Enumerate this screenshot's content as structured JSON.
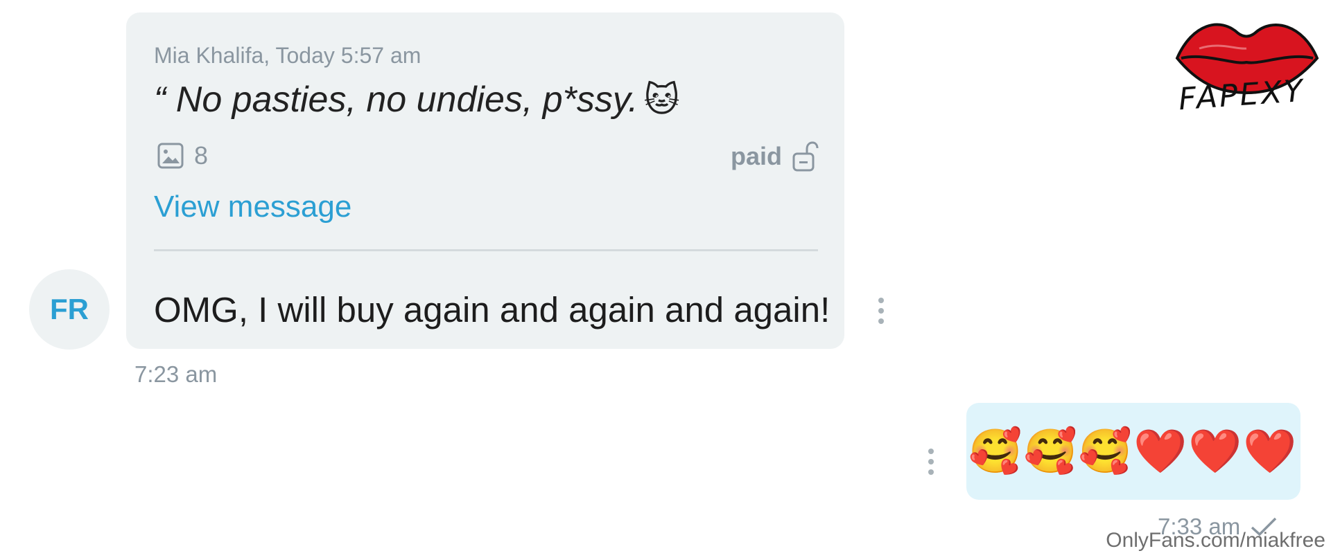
{
  "avatar": {
    "initials": "FR"
  },
  "incoming": {
    "quote_meta": "Mia Khalifa, Today 5:57 am",
    "quote_text": "“ No pasties, no undies, p*ssy.",
    "quote_emoji": "🐱",
    "media_count": "8",
    "price_status": "paid",
    "view_link": "View message",
    "message": "OMG, I will buy again and again and again!",
    "time": "7:23 am"
  },
  "outgoing": {
    "message": "🥰🥰🥰❤️❤️❤️",
    "time": "7:33 am"
  },
  "watermark": "OnlyFans.com/miakfree",
  "logo_text": "FAPEXY",
  "icons": {
    "media": "image-icon",
    "lock": "unlock-icon",
    "more": "more-vertical-icon",
    "check": "checkmark-icon"
  },
  "colors": {
    "accent": "#2b9fd3",
    "bubble_in": "#eef2f3",
    "bubble_out": "#dff4fb",
    "muted_text": "#8a96a0",
    "logo_red": "#d8141f"
  }
}
